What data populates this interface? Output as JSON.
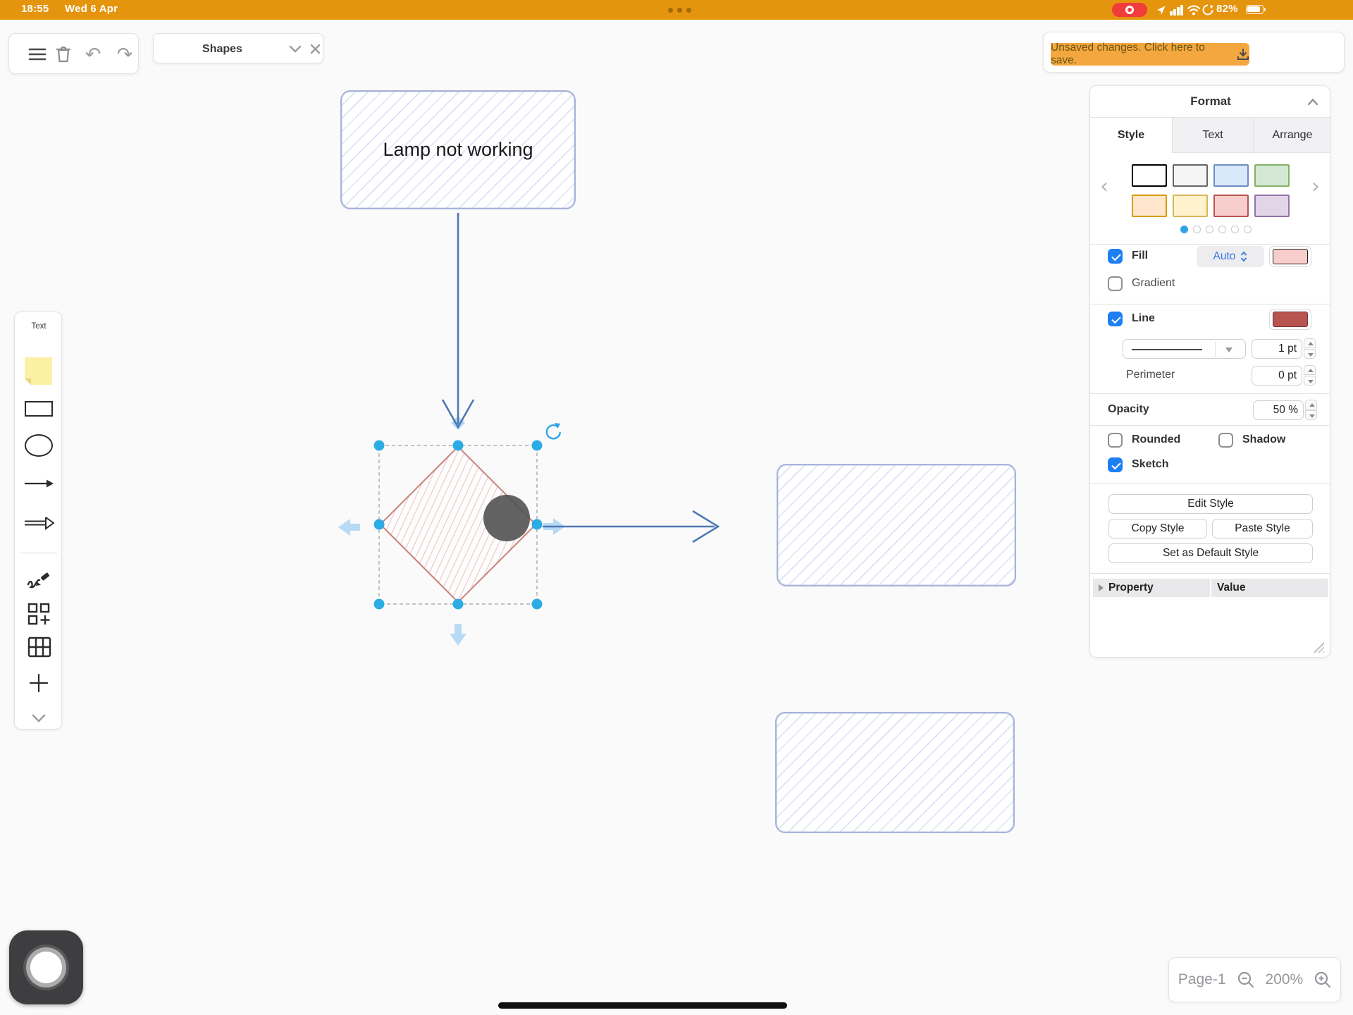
{
  "status_bar": {
    "time": "18:55",
    "date": "Wed 6 Apr",
    "battery_percent": "82%"
  },
  "top_toolbar": {
    "menu": "menu",
    "delete": "delete",
    "undo": "undo",
    "redo": "redo"
  },
  "icons": {
    "undo": "↶",
    "redo": "↷",
    "chevron_left": "‹",
    "chevron_right": "›"
  },
  "shapes_panel": {
    "title": "Shapes"
  },
  "save_banner": {
    "label": "Unsaved changes. Click here to save."
  },
  "canvas": {
    "lamp_label": "Lamp not working",
    "shapes": [
      "rounded-rectangle: Lamp not working",
      "diamond (selected, empty)",
      "rounded-rectangle (empty)",
      "rounded-rectangle (empty)"
    ],
    "colors": {
      "sketch_blue_stroke": "#A6B4DA",
      "sketch_red_stroke": "#C8827C",
      "arrow_blue": "#4D79B3",
      "selection_handle": "#2CACE4",
      "nudge_arrow": "#B7DAF5"
    }
  },
  "left_toolbar": {
    "text_tool_label": "Text"
  },
  "format_panel": {
    "title": "Format",
    "tabs": [
      {
        "label": "Style",
        "active": true
      },
      {
        "label": "Text",
        "active": false
      },
      {
        "label": "Arrange",
        "active": false
      }
    ],
    "style_presets": [
      {
        "fill": "#FFFFFF",
        "stroke": "#000000"
      },
      {
        "fill": "#F5F5F5",
        "stroke": "#666666"
      },
      {
        "fill": "#DAE8FC",
        "stroke": "#6C8EBF"
      },
      {
        "fill": "#D5E8D4",
        "stroke": "#82B366"
      },
      {
        "fill": "#FFE6CC",
        "stroke": "#D79B00"
      },
      {
        "fill": "#FFF2CC",
        "stroke": "#D6B656"
      },
      {
        "fill": "#F8CECC",
        "stroke": "#B85450"
      },
      {
        "fill": "#E1D5E7",
        "stroke": "#9673A6"
      }
    ],
    "pagination": {
      "count": 6,
      "active_index": 0
    },
    "fill": {
      "label": "Fill",
      "checked": true,
      "mode": "Auto",
      "color": "#F8CECC"
    },
    "gradient": {
      "label": "Gradient",
      "checked": false
    },
    "line": {
      "label": "Line",
      "checked": true,
      "color": "#B85450",
      "width": "1 pt"
    },
    "perimeter": {
      "label": "Perimeter",
      "value": "0 pt"
    },
    "opacity": {
      "label": "Opacity",
      "value": "50 %"
    },
    "rounded": {
      "label": "Rounded",
      "checked": false
    },
    "shadow": {
      "label": "Shadow",
      "checked": false
    },
    "sketch": {
      "label": "Sketch",
      "checked": true
    },
    "buttons": {
      "edit_style": "Edit Style",
      "copy_style": "Copy Style",
      "paste_style": "Paste Style",
      "set_default": "Set as Default Style"
    },
    "property_table": {
      "property_header": "Property",
      "value_header": "Value"
    }
  },
  "page_controls": {
    "page": "Page-1",
    "zoom": "200%"
  }
}
